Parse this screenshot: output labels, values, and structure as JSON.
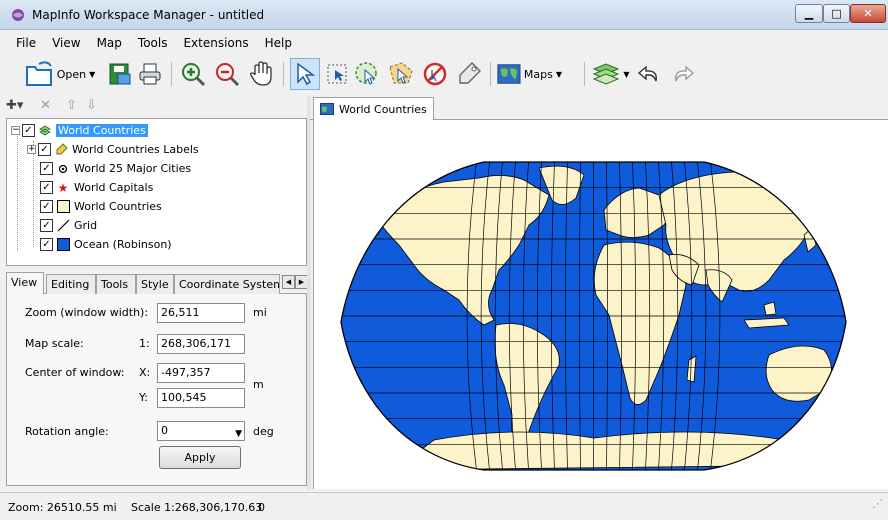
{
  "window": {
    "title": "MapInfo Workspace Manager - untitled"
  },
  "menu": [
    "File",
    "View",
    "Map",
    "Tools",
    "Extensions",
    "Help"
  ],
  "toolbar": {
    "open_label": "Open",
    "maps_label": "Maps"
  },
  "layers": [
    {
      "label": "World Countries",
      "checked": true,
      "selected": true,
      "icon": "layers-icon",
      "level": 0
    },
    {
      "label": "World Countries Labels",
      "checked": true,
      "icon": "label-tag-icon",
      "level": 1
    },
    {
      "label": "World 25 Major Cities",
      "checked": true,
      "icon": "point-dot-icon",
      "level": 1
    },
    {
      "label": "World Capitals",
      "checked": true,
      "icon": "red-star-icon",
      "level": 1
    },
    {
      "label": "World Countries",
      "checked": true,
      "icon": "cream-region-icon",
      "level": 1
    },
    {
      "label": "Grid",
      "checked": true,
      "icon": "line-icon",
      "level": 1
    },
    {
      "label": "Ocean (Robinson)",
      "checked": true,
      "icon": "blue-region-icon",
      "level": 1
    }
  ],
  "tabs": [
    "View",
    "Editing",
    "Tools",
    "Style",
    "Coordinate System"
  ],
  "view_panel": {
    "zoom_label": "Zoom (window width):",
    "zoom_value": "26,511",
    "zoom_unit": "mi",
    "scale_label": "Map scale:",
    "scale_prefix": "1:",
    "scale_value": "268,306,171",
    "center_label": "Center of window:",
    "x_label": "X:",
    "x_value": "-497,357",
    "y_label": "Y:",
    "y_value": "100,545",
    "center_unit": "m",
    "rotation_label": "Rotation angle:",
    "rotation_value": "0",
    "rotation_unit": "deg",
    "apply_label": "Apply"
  },
  "map_tab": {
    "label": "World Countries"
  },
  "status": {
    "zoom": "Zoom: 26510.55 mi",
    "scale": "Scale 1:268,306,170.63",
    "extra": "0"
  },
  "colors": {
    "ocean": "#0f5bdc",
    "land": "#fdf3c8",
    "selection": "#3399ff"
  }
}
